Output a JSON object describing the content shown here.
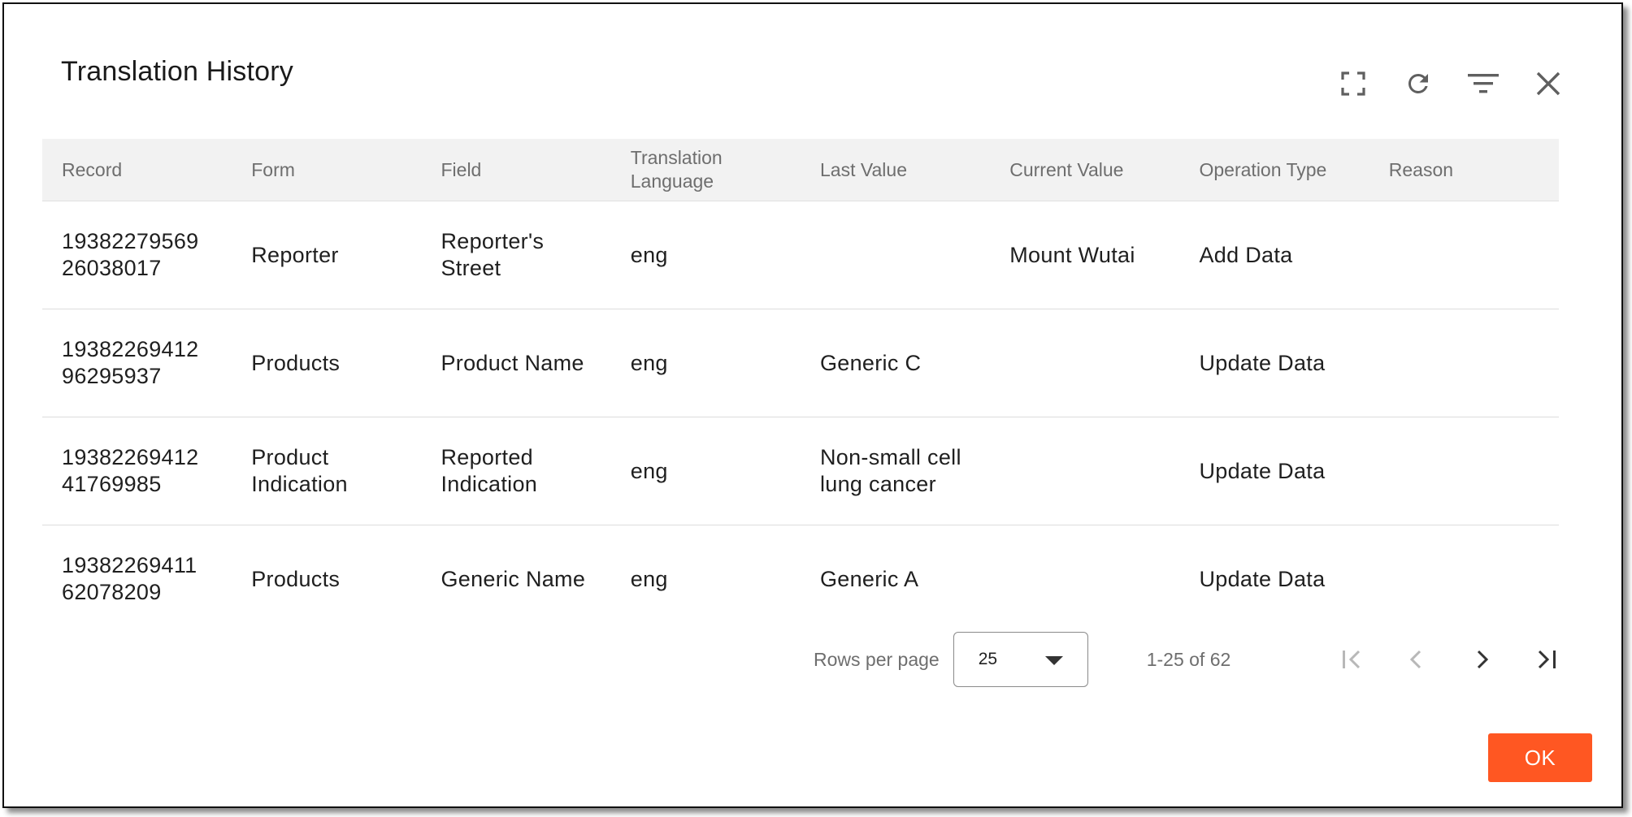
{
  "dialog": {
    "title": "Translation History",
    "ok_label": "OK"
  },
  "icons": {
    "fullscreen": "fullscreen-icon",
    "refresh": "refresh-icon",
    "filter": "filter-icon",
    "close": "close-icon"
  },
  "table": {
    "columns": [
      "Record",
      "Form",
      "Field",
      "Translation Language",
      "Last Value",
      "Current Value",
      "Operation Type",
      "Reason"
    ],
    "rows": [
      {
        "record": "1938227956926038017",
        "form": "Reporter",
        "field": "Reporter's Street",
        "language": "eng",
        "last_value": "",
        "current_value": "Mount Wutai",
        "operation": "Add Data",
        "reason": ""
      },
      {
        "record": "1938226941296295937",
        "form": "Products",
        "field": "Product Name",
        "language": "eng",
        "last_value": "Generic C",
        "current_value": "",
        "operation": "Update Data",
        "reason": ""
      },
      {
        "record": "1938226941241769985",
        "form": "Product Indication",
        "field": "Reported Indication",
        "language": "eng",
        "last_value": "Non-small cell lung cancer",
        "current_value": "",
        "operation": "Update Data",
        "reason": ""
      },
      {
        "record": "1938226941162078209",
        "form": "Products",
        "field": "Generic Name",
        "language": "eng",
        "last_value": "Generic A",
        "current_value": "",
        "operation": "Update Data",
        "reason": ""
      }
    ]
  },
  "pagination": {
    "rows_per_page_label": "Rows per page",
    "rows_per_page_value": "25",
    "range_text": "1-25 of 62"
  },
  "colors": {
    "accent": "#ff5722",
    "header_bg": "#f2f2f2"
  }
}
